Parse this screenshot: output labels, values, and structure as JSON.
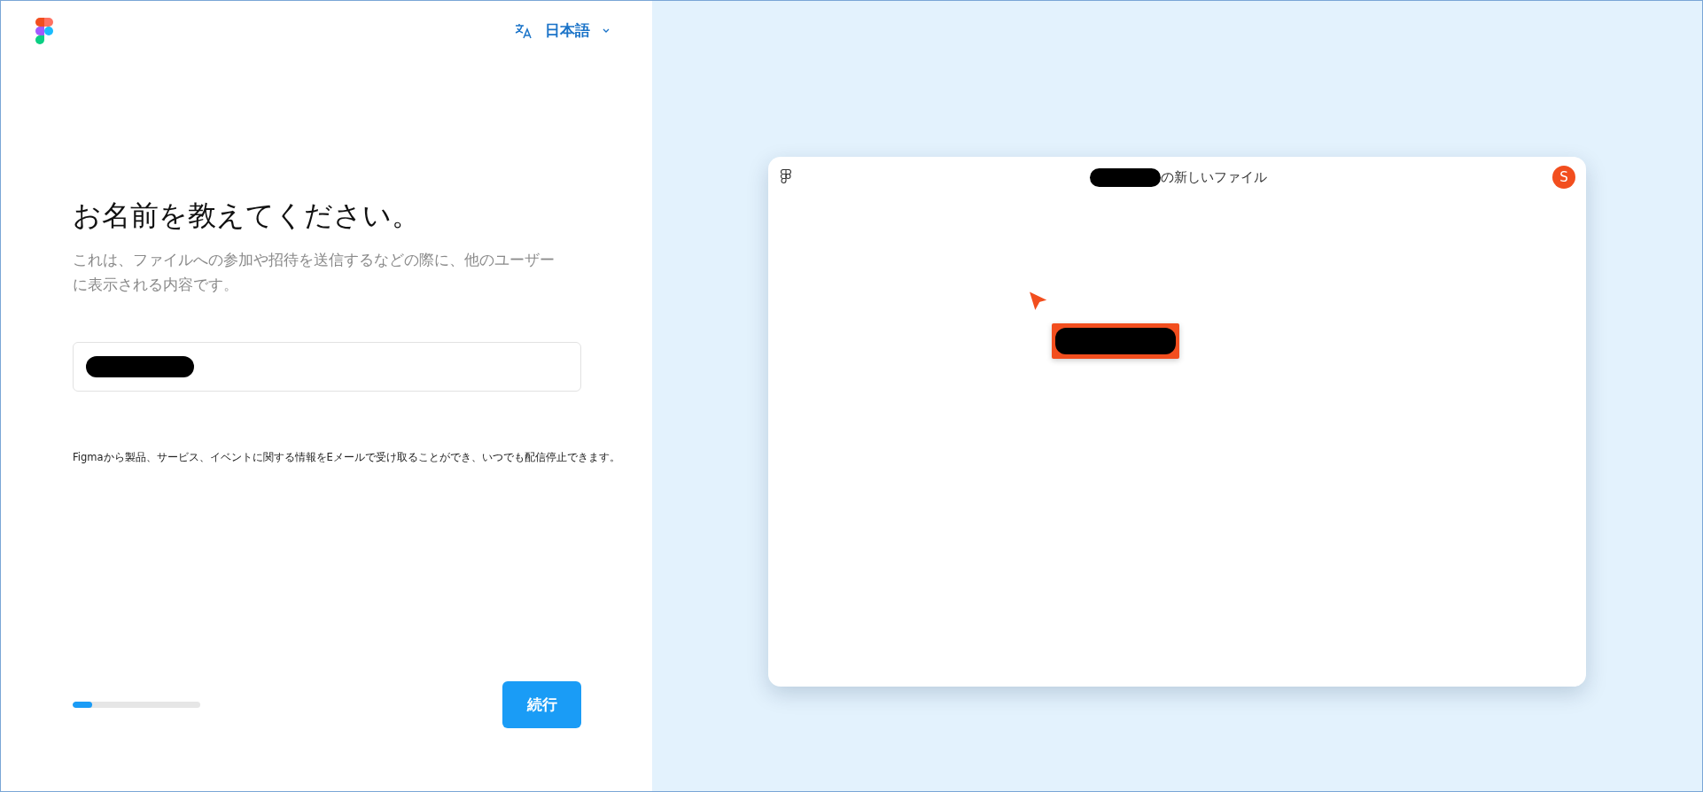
{
  "language_selector": {
    "label": "日本語"
  },
  "heading": "お名前を教えてください。",
  "description": "これは、ファイルへの参加や招待を送信するなどの際に、他のユーザーに表示される内容です。",
  "notice": "Figmaから製品、サービス、イベントに関する情報をEメールで受け取ることができ、いつでも配信停止できます。",
  "progress": {
    "level": 0.15
  },
  "continue_button": {
    "label": "続行"
  },
  "preview": {
    "title_suffix": "の新しいファイル",
    "avatar": "S"
  }
}
